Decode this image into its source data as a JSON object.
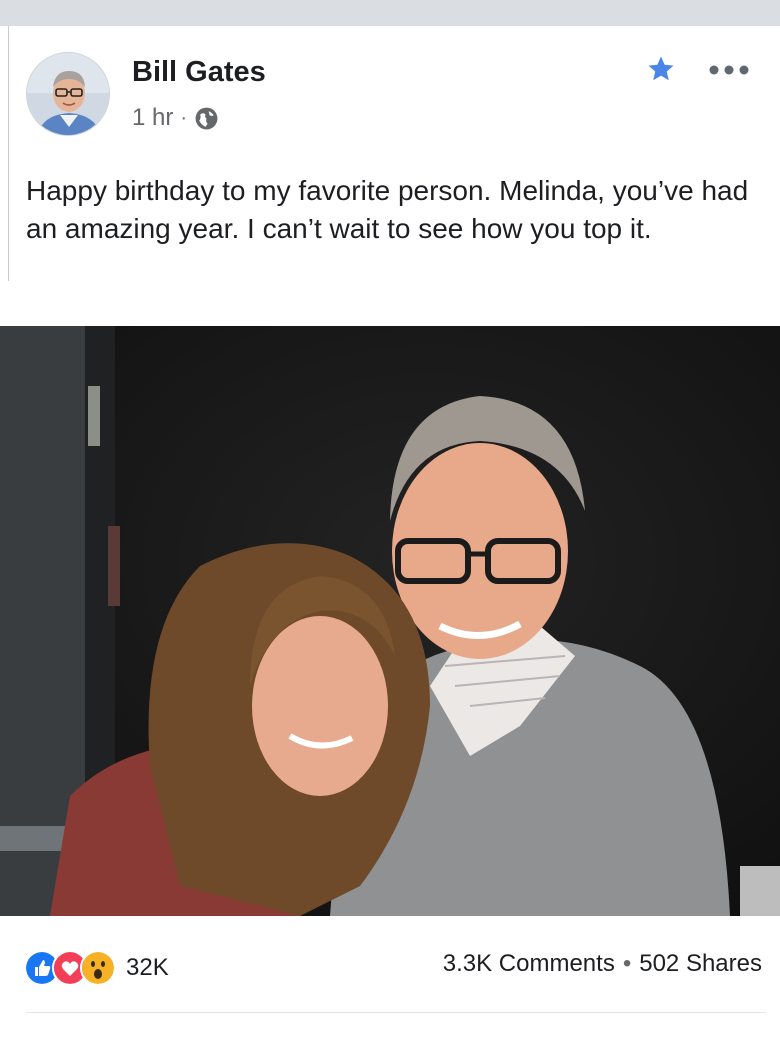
{
  "post": {
    "author": "Bill Gates",
    "time": "1 hr",
    "separator": "·",
    "caption": "Happy birthday to my favorite person. Melinda, you’ve had an amazing year. I can’t wait to see how you top it.",
    "privacy_icon": "globe-icon",
    "favorite_icon": "star-icon",
    "favorite_color": "#4a86e8",
    "more_icon": "more-options-icon"
  },
  "engagement": {
    "reaction_icons": [
      "like-icon",
      "love-icon",
      "wow-icon"
    ],
    "reaction_count": "32K",
    "comments": "3.3K Comments",
    "separator": "•",
    "shares": "502 Shares"
  },
  "colors": {
    "like": "#1877f2",
    "love": "#f33e58",
    "wow": "#f7b125"
  }
}
